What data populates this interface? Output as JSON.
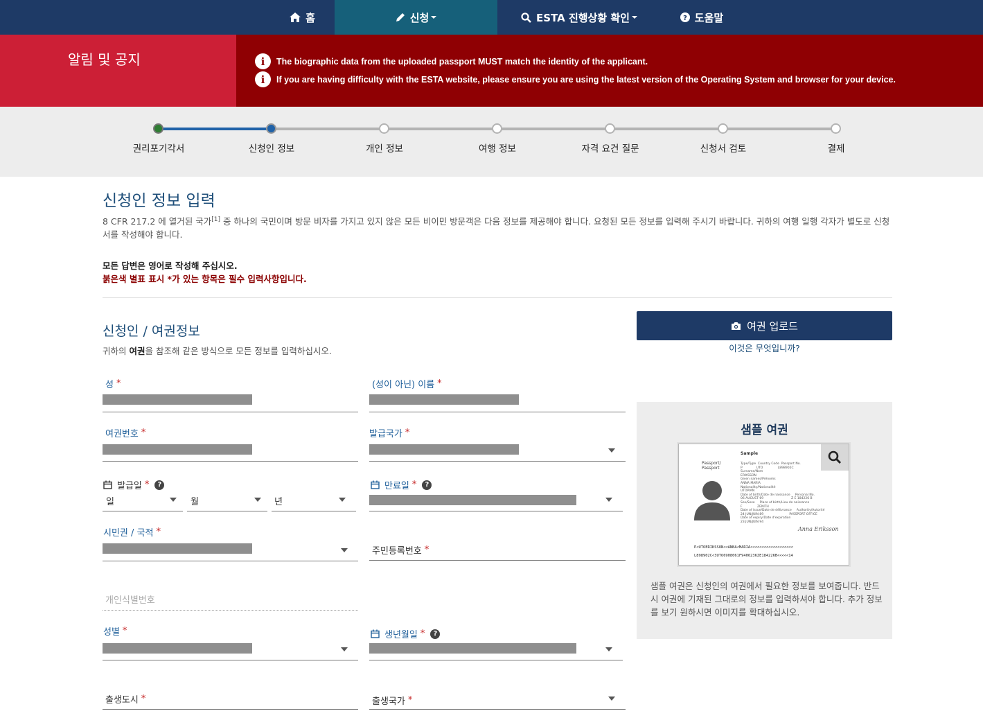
{
  "nav": {
    "home": "홈",
    "apply": "신청",
    "status": "ESTA 진행상황 확인",
    "help": "도움말",
    "icons": [
      "home-icon",
      "pencil-icon",
      "search-icon",
      "question-circle-icon"
    ],
    "colors": {
      "bar": "#1e3a66",
      "active": "#16607a"
    }
  },
  "alert": {
    "title": "알림 및 공지",
    "messages": [
      "The biographic data from the uploaded passport MUST match the identity of the applicant.",
      "If you are having difficulty with the ESTA website, please ensure you are using the latest version of the Operating System and browser for your device."
    ],
    "colors": {
      "left": "#cc1f36",
      "right": "#8f0003"
    }
  },
  "progress": {
    "steps": [
      "권리포기각서",
      "신청인 정보",
      "개인 정보",
      "여행 정보",
      "자격 요건 질문",
      "신청서 검토",
      "결제"
    ],
    "current_step": 2
  },
  "page": {
    "title": "신청인 정보 입력",
    "intro_before": "8 CFR 217.2 에 열거된 국가",
    "intro_sup": "[1]",
    "intro_after": " 중 하나의 국민이며 방문 비자를 가지고 있지 않은 모든 비이민 방문객은 다음 정보를 제공해야 합니다. 요청된 모든 정보를 입력해 주시기 바랍니다. 귀하의 여행 일행 각자가 별도로 신청서를 작성해야 합니다.",
    "note_english": "모든 답변은 영어로 작성해 주십시오.",
    "note_required": "붉은색 별표 표시 *가 있는 항목은 필수 입력사항입니다."
  },
  "section": {
    "title": "신청인 / 여권정보",
    "desc_before": "귀하의 ",
    "desc_bold": "여권",
    "desc_after": "을 참조해 같은 방식으로 모든 정보를 입력하십시오."
  },
  "fields": {
    "surname": "성",
    "given_name": "(성이 아닌) 이름",
    "passport_number": "여권번호",
    "issuing_country": "발급국가",
    "issue_date": "발급일",
    "expiry_date": "만료일",
    "day": "일",
    "month": "월",
    "year": "년",
    "citizenship": "시민권 / 국적",
    "national_id": "주민등록번호",
    "personal_id_placeholder": "개인식별번호",
    "gender": "성별",
    "birth_date": "생년월일",
    "birth_city": "출생도시",
    "birth_country": "출생국가",
    "required_mark": "*"
  },
  "upload": {
    "button": "여권 업로드",
    "what_is_this": "이것은 무엇입니까?"
  },
  "sample": {
    "title": "샘플 여권",
    "passport": {
      "side": "Passport/\nPassport",
      "header": "Sample",
      "fields": "Type/Type  Country Code  Passport No.\nP              UTO               L898902C\nSurname/Nom\nERIKSSON\nGiven names/Prénoms\nANNA MARIA\nNationality/Nationalité\nUTOPIAN\nDate of birth/Date de naissance     Personal No.\n06 AUGUST 69                            Z E 184226 B\nSex/Sexe     Place of birth/Lieu de naissance\nF               ZENITH\nDate of issue/Date de délivrance     Authority/Autorité\n24 JUN/JUIN 89                          PASSPORT OFFICE\nDate of expiry/Date d'expiration\n23 JUN/JUIN 94",
      "signature": "Anna Eriksson",
      "mrz1": "P<UTOERIKSSON<<ANNA<MARIA<<<<<<<<<<<<<<<<<<<",
      "mrz2": "L898902C<3UTO6908061F9406236ZE184226B<<<<<14"
    },
    "description": "샘플 여권은 신청인의 여권에서 필요한 정보를 보여줍니다. 반드시 여권에 기재된 그대로의 정보를 입력하셔야 합니다. 추가 정보를 보기 원하시면 이미지를 확대하십시오."
  }
}
